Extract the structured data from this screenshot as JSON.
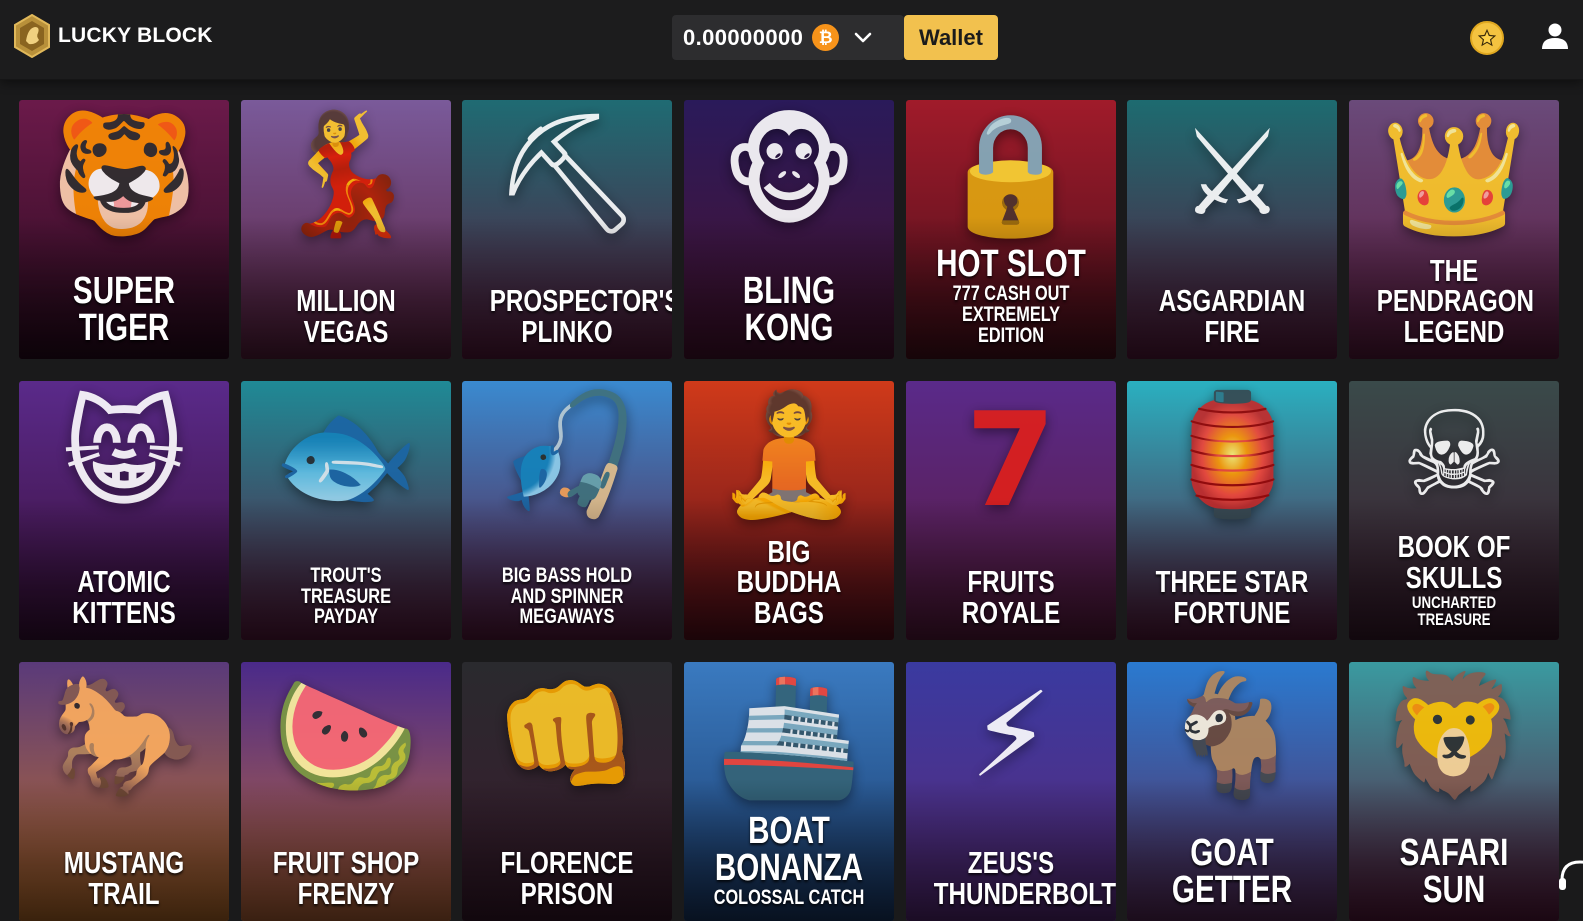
{
  "header": {
    "logo_text": "LUCKY BLOCK",
    "balance": "0.00000000",
    "currency_symbol": "₿",
    "wallet_label": "Wallet",
    "accent_color": "#f2c14e",
    "icons": [
      "logo-icon",
      "bitcoin-icon",
      "chevron-down-icon",
      "star-icon",
      "user-icon"
    ]
  },
  "games": [
    {
      "title": "SUPER TIGER",
      "subtitle": "",
      "icon": "tiger-icon",
      "colors": [
        "#6b1a4a",
        "#2a0a1e"
      ],
      "glyph": "🐯"
    },
    {
      "title": "MILLION VEGAS",
      "subtitle": "",
      "icon": "showgirl-icon",
      "colors": [
        "#7a5a9a",
        "#5a1f3d"
      ],
      "glyph": "💃"
    },
    {
      "title": "PROSPECTOR'S PLINKO",
      "subtitle": "",
      "icon": "miner-icon",
      "colors": [
        "#1f6b73",
        "#5a1a3d"
      ],
      "glyph": "⛏"
    },
    {
      "title": "BLING KONG",
      "subtitle": "",
      "icon": "monkey-icon",
      "colors": [
        "#2a1a5a",
        "#4a1230"
      ],
      "glyph": "🐵"
    },
    {
      "title": "HOT SLOT",
      "subtitle": "777 CASH OUT EXTREMELY EDITION",
      "icon": "safe-icon",
      "colors": [
        "#a01b2a",
        "#4a0f1c"
      ],
      "glyph": "🔒"
    },
    {
      "title": "ASGARDIAN FIRE",
      "subtitle": "",
      "icon": "viking-icon",
      "colors": [
        "#1d6b70",
        "#5a1a3d"
      ],
      "glyph": "⚔"
    },
    {
      "title": "THE PENDRAGON LEGEND",
      "subtitle": "",
      "icon": "princess-icon",
      "colors": [
        "#6a4a7a",
        "#5a1a3d"
      ],
      "glyph": "👑"
    },
    {
      "title": "ATOMIC KITTENS",
      "subtitle": "",
      "icon": "cat-icon",
      "colors": [
        "#5a2a8a",
        "#3a0f38"
      ],
      "glyph": "😸"
    },
    {
      "title": "TROUT'S TREASURE PAYDAY",
      "subtitle": "",
      "icon": "fisherman-icon",
      "colors": [
        "#1f8a96",
        "#5a1a3d"
      ],
      "glyph": "🐟"
    },
    {
      "title": "BIG BASS HOLD AND SPINNER MEGAWAYS",
      "subtitle": "",
      "icon": "fishing-boat-icon",
      "colors": [
        "#3a8ad0",
        "#5a1a3d"
      ],
      "glyph": "🎣"
    },
    {
      "title": "BIG BUDDHA BAGS",
      "subtitle": "",
      "icon": "buddha-icon",
      "colors": [
        "#d03a1a",
        "#5a0f1c"
      ],
      "glyph": "🧘"
    },
    {
      "title": "FRUITS ROYALE",
      "subtitle": "",
      "icon": "seven-icon",
      "colors": [
        "#5a2a8a",
        "#5a1a3d"
      ],
      "glyph": "7"
    },
    {
      "title": "THREE STAR FORTUNE",
      "subtitle": "",
      "icon": "emperor-icon",
      "colors": [
        "#2ab0c0",
        "#5a1a3d"
      ],
      "glyph": "🏮"
    },
    {
      "title": "BOOK OF SKULLS",
      "subtitle": "UNCHARTED TREASURE",
      "icon": "pirate-icon",
      "colors": [
        "#3a4a4a",
        "#3a1a2d"
      ],
      "glyph": "☠"
    },
    {
      "title": "MUSTANG TRAIL",
      "subtitle": "",
      "icon": "horse-icon",
      "colors": [
        "#5a3a7a",
        "#c0702a"
      ],
      "glyph": "🐎"
    },
    {
      "title": "FRUIT SHOP FRENZY",
      "subtitle": "",
      "icon": "watermelon-icon",
      "colors": [
        "#4a2a8a",
        "#c06a3a"
      ],
      "glyph": "🍉"
    },
    {
      "title": "FLORENCE PRISON",
      "subtitle": "",
      "icon": "brass-knuckles-icon",
      "colors": [
        "#2a2a2e",
        "#3a1a2d"
      ],
      "glyph": "👊"
    },
    {
      "title": "BOAT BONANZA",
      "subtitle": "COLOSSAL CATCH",
      "icon": "ship-icon",
      "colors": [
        "#3a7ac0",
        "#1a3a6a"
      ],
      "glyph": "🚢"
    },
    {
      "title": "ZEUS'S THUNDERBOLT",
      "subtitle": "",
      "icon": "zeus-icon",
      "colors": [
        "#3a3aa0",
        "#5a2a7a"
      ],
      "glyph": "⚡"
    },
    {
      "title": "GOAT GETTER",
      "subtitle": "",
      "icon": "goat-icon",
      "colors": [
        "#2a7ad0",
        "#5a2a5a"
      ],
      "glyph": "🐐"
    },
    {
      "title": "SAFARI SUN",
      "subtitle": "",
      "icon": "lion-icon",
      "colors": [
        "#3a9aa0",
        "#5a1a3d"
      ],
      "glyph": "🦁"
    }
  ]
}
